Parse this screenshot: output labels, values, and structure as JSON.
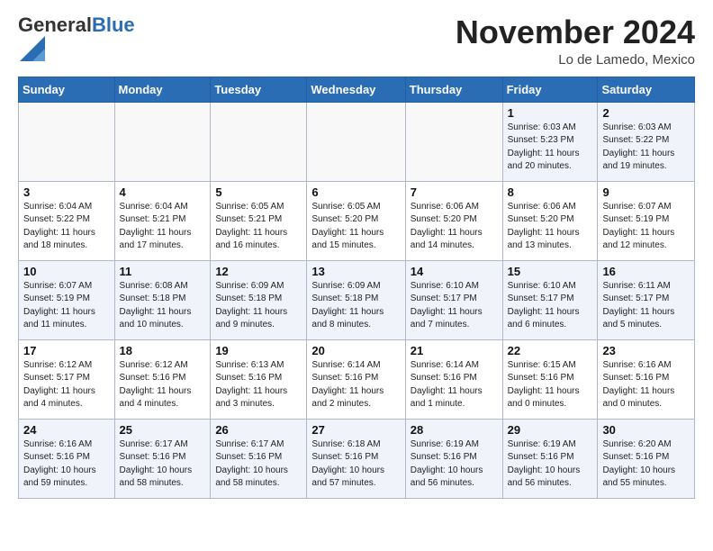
{
  "header": {
    "logo_general": "General",
    "logo_blue": "Blue",
    "month_title": "November 2024",
    "location": "Lo de Lamedo, Mexico"
  },
  "days_of_week": [
    "Sunday",
    "Monday",
    "Tuesday",
    "Wednesday",
    "Thursday",
    "Friday",
    "Saturday"
  ],
  "weeks": [
    [
      {
        "day": "",
        "info": ""
      },
      {
        "day": "",
        "info": ""
      },
      {
        "day": "",
        "info": ""
      },
      {
        "day": "",
        "info": ""
      },
      {
        "day": "",
        "info": ""
      },
      {
        "day": "1",
        "info": "Sunrise: 6:03 AM\nSunset: 5:23 PM\nDaylight: 11 hours and 20 minutes."
      },
      {
        "day": "2",
        "info": "Sunrise: 6:03 AM\nSunset: 5:22 PM\nDaylight: 11 hours and 19 minutes."
      }
    ],
    [
      {
        "day": "3",
        "info": "Sunrise: 6:04 AM\nSunset: 5:22 PM\nDaylight: 11 hours and 18 minutes."
      },
      {
        "day": "4",
        "info": "Sunrise: 6:04 AM\nSunset: 5:21 PM\nDaylight: 11 hours and 17 minutes."
      },
      {
        "day": "5",
        "info": "Sunrise: 6:05 AM\nSunset: 5:21 PM\nDaylight: 11 hours and 16 minutes."
      },
      {
        "day": "6",
        "info": "Sunrise: 6:05 AM\nSunset: 5:20 PM\nDaylight: 11 hours and 15 minutes."
      },
      {
        "day": "7",
        "info": "Sunrise: 6:06 AM\nSunset: 5:20 PM\nDaylight: 11 hours and 14 minutes."
      },
      {
        "day": "8",
        "info": "Sunrise: 6:06 AM\nSunset: 5:20 PM\nDaylight: 11 hours and 13 minutes."
      },
      {
        "day": "9",
        "info": "Sunrise: 6:07 AM\nSunset: 5:19 PM\nDaylight: 11 hours and 12 minutes."
      }
    ],
    [
      {
        "day": "10",
        "info": "Sunrise: 6:07 AM\nSunset: 5:19 PM\nDaylight: 11 hours and 11 minutes."
      },
      {
        "day": "11",
        "info": "Sunrise: 6:08 AM\nSunset: 5:18 PM\nDaylight: 11 hours and 10 minutes."
      },
      {
        "day": "12",
        "info": "Sunrise: 6:09 AM\nSunset: 5:18 PM\nDaylight: 11 hours and 9 minutes."
      },
      {
        "day": "13",
        "info": "Sunrise: 6:09 AM\nSunset: 5:18 PM\nDaylight: 11 hours and 8 minutes."
      },
      {
        "day": "14",
        "info": "Sunrise: 6:10 AM\nSunset: 5:17 PM\nDaylight: 11 hours and 7 minutes."
      },
      {
        "day": "15",
        "info": "Sunrise: 6:10 AM\nSunset: 5:17 PM\nDaylight: 11 hours and 6 minutes."
      },
      {
        "day": "16",
        "info": "Sunrise: 6:11 AM\nSunset: 5:17 PM\nDaylight: 11 hours and 5 minutes."
      }
    ],
    [
      {
        "day": "17",
        "info": "Sunrise: 6:12 AM\nSunset: 5:17 PM\nDaylight: 11 hours and 4 minutes."
      },
      {
        "day": "18",
        "info": "Sunrise: 6:12 AM\nSunset: 5:16 PM\nDaylight: 11 hours and 4 minutes."
      },
      {
        "day": "19",
        "info": "Sunrise: 6:13 AM\nSunset: 5:16 PM\nDaylight: 11 hours and 3 minutes."
      },
      {
        "day": "20",
        "info": "Sunrise: 6:14 AM\nSunset: 5:16 PM\nDaylight: 11 hours and 2 minutes."
      },
      {
        "day": "21",
        "info": "Sunrise: 6:14 AM\nSunset: 5:16 PM\nDaylight: 11 hours and 1 minute."
      },
      {
        "day": "22",
        "info": "Sunrise: 6:15 AM\nSunset: 5:16 PM\nDaylight: 11 hours and 0 minutes."
      },
      {
        "day": "23",
        "info": "Sunrise: 6:16 AM\nSunset: 5:16 PM\nDaylight: 11 hours and 0 minutes."
      }
    ],
    [
      {
        "day": "24",
        "info": "Sunrise: 6:16 AM\nSunset: 5:16 PM\nDaylight: 10 hours and 59 minutes."
      },
      {
        "day": "25",
        "info": "Sunrise: 6:17 AM\nSunset: 5:16 PM\nDaylight: 10 hours and 58 minutes."
      },
      {
        "day": "26",
        "info": "Sunrise: 6:17 AM\nSunset: 5:16 PM\nDaylight: 10 hours and 58 minutes."
      },
      {
        "day": "27",
        "info": "Sunrise: 6:18 AM\nSunset: 5:16 PM\nDaylight: 10 hours and 57 minutes."
      },
      {
        "day": "28",
        "info": "Sunrise: 6:19 AM\nSunset: 5:16 PM\nDaylight: 10 hours and 56 minutes."
      },
      {
        "day": "29",
        "info": "Sunrise: 6:19 AM\nSunset: 5:16 PM\nDaylight: 10 hours and 56 minutes."
      },
      {
        "day": "30",
        "info": "Sunrise: 6:20 AM\nSunset: 5:16 PM\nDaylight: 10 hours and 55 minutes."
      }
    ]
  ]
}
